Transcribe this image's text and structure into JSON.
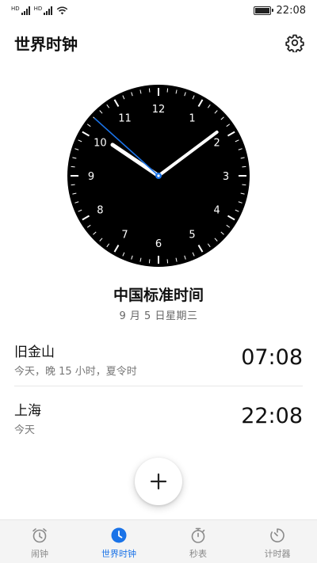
{
  "status_bar": {
    "sim1_label": "HD",
    "sim2_label": "HD",
    "time": "22:08"
  },
  "header": {
    "title": "世界时钟",
    "settings_icon": "gear-icon"
  },
  "clock": {
    "numerals": [
      "12",
      "1",
      "2",
      "3",
      "4",
      "5",
      "6",
      "7",
      "8",
      "9",
      "10",
      "11"
    ],
    "hour": 22,
    "minute": 8,
    "second": 52,
    "colors": {
      "face": "#000000",
      "hands": "#ffffff",
      "second_hand": "#1a73e8",
      "center": "#1a73e8"
    }
  },
  "local": {
    "zone_name": "中国标准时间",
    "date": "9 月 5 日星期三"
  },
  "cities": [
    {
      "name": "旧金山",
      "subtitle": "今天，晚 15 小时，夏令时",
      "time": "07:08"
    },
    {
      "name": "上海",
      "subtitle": "今天",
      "time": "22:08"
    }
  ],
  "fab": {
    "icon": "plus-icon"
  },
  "nav": {
    "items": [
      {
        "label": "闹钟",
        "icon": "alarm-icon",
        "active": false
      },
      {
        "label": "世界时钟",
        "icon": "world-clock-icon",
        "active": true
      },
      {
        "label": "秒表",
        "icon": "stopwatch-icon",
        "active": false
      },
      {
        "label": "计时器",
        "icon": "timer-icon",
        "active": false
      }
    ]
  },
  "colors": {
    "accent": "#1a73e8",
    "inactive": "#8a8a8a"
  }
}
